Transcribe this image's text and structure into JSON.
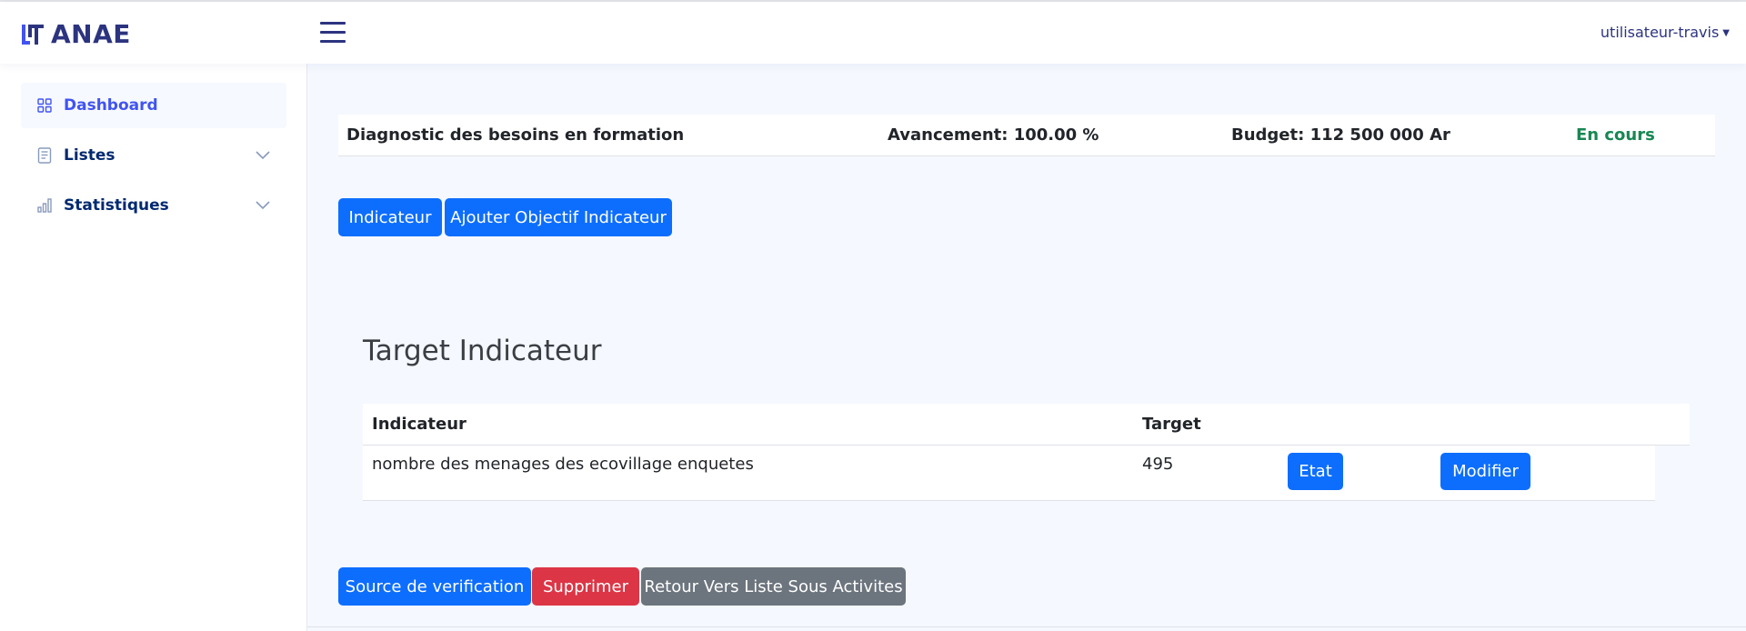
{
  "header": {
    "brand": "ANAE",
    "user_menu": "utilisateur-travis"
  },
  "sidebar": {
    "items": [
      {
        "label": "Dashboard",
        "icon": "grid-icon",
        "active": true
      },
      {
        "label": "Listes",
        "icon": "list-document-icon",
        "expandable": true
      },
      {
        "label": "Statistiques",
        "icon": "bar-chart-icon",
        "expandable": true
      }
    ]
  },
  "project": {
    "title": "Diagnostic des besoins en formation",
    "progress": "Avancement: 100.00 %",
    "budget": "Budget: 112 500 000 Ar",
    "status": "En cours"
  },
  "actions": {
    "indicateur": "Indicateur",
    "ajouter_objectif": "Ajouter Objectif Indicateur"
  },
  "target_section": {
    "title": "Target Indicateur",
    "columns": [
      "Indicateur",
      "Target"
    ],
    "rows": [
      {
        "indicateur": "nombre des menages des ecovillage enquetes",
        "target": "495",
        "etat_label": "Etat",
        "modifier_label": "Modifier"
      }
    ]
  },
  "footer_actions": {
    "source": "Source de verification",
    "supprimer": "Supprimer",
    "retour": "Retour Vers Liste Sous Activites"
  },
  "colors": {
    "brand": "#2c3480",
    "primary": "#0d6efd",
    "danger": "#dc3545",
    "secondary": "#6c757d",
    "success": "#198754",
    "background": "#f5f8fe"
  }
}
